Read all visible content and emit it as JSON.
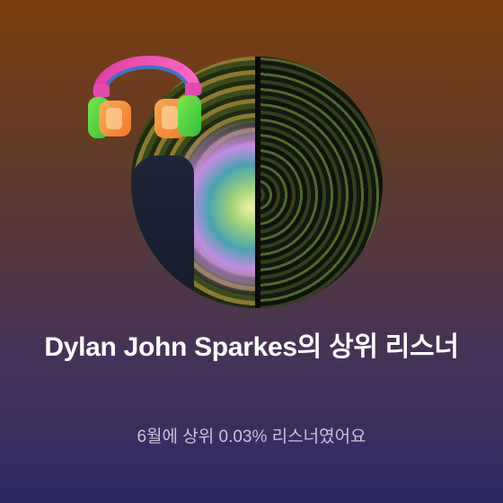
{
  "card": {
    "title": "Dylan John Sparkes의 상위 리스너",
    "subtitle_text": "6월에 상위 0.03% 리스너였어요",
    "top_percent": "0.03%",
    "month": "6월"
  },
  "icons": {
    "headphones": "headphones-icon"
  },
  "colors": {
    "bg_top": "#7a3f0f",
    "bg_bottom": "#2f2a63",
    "title": "#ffffff",
    "subtitle": "#c9c3d8"
  }
}
